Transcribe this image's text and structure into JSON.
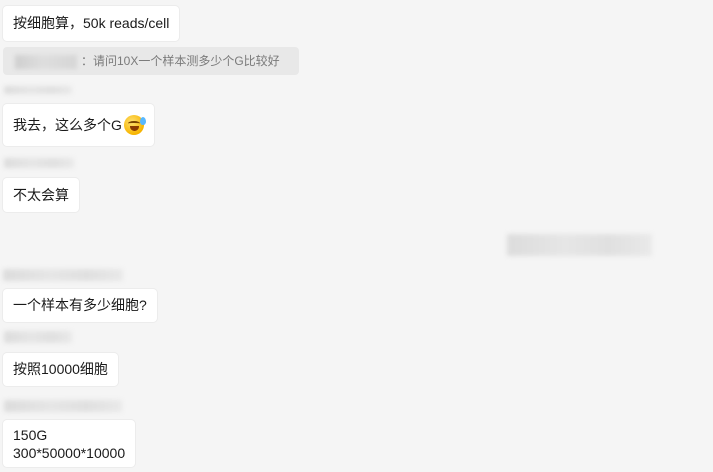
{
  "messages": {
    "m1": "按细胞算，50k reads/cell",
    "quote": "：请问10X一个样本测多少个G比较好",
    "m2": "我去，这么多个G",
    "m3": "不太会算",
    "m4": "一个样本有多少细胞?",
    "m5": "按照10000细胞",
    "m6_line1": "150G",
    "m6_line2": "300*50000*10000"
  },
  "icons": {
    "emoji": "rolling-on-floor-laughing-icon"
  }
}
